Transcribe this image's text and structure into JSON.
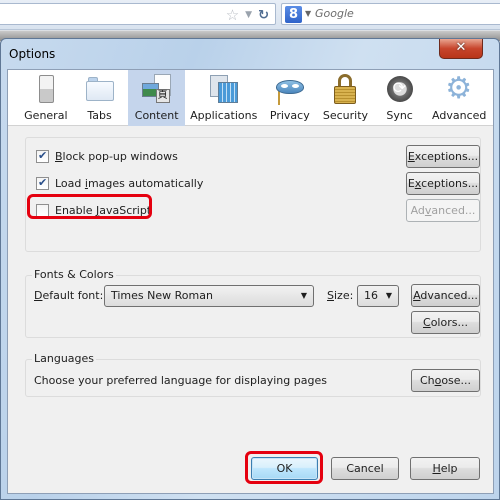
{
  "browser": {
    "bookmark_icon": "star-icon",
    "dropmarker_icon": "dropdown-arrow-icon",
    "reload_icon": "reload-icon",
    "search_engine_icon": "google-icon",
    "search_engine_letter": "8",
    "search_placeholder": "Google"
  },
  "dialog": {
    "title": "Options",
    "close_symbol": "✕",
    "panes": [
      {
        "label": "General",
        "icon": "switch-icon",
        "selected": false
      },
      {
        "label": "Tabs",
        "icon": "folder-tab-icon",
        "selected": false
      },
      {
        "label": "Content",
        "icon": "content-icon",
        "selected": true
      },
      {
        "label": "Applications",
        "icon": "applications-icon",
        "selected": false
      },
      {
        "label": "Privacy",
        "icon": "mask-icon",
        "selected": false
      },
      {
        "label": "Security",
        "icon": "padlock-icon",
        "selected": false
      },
      {
        "label": "Sync",
        "icon": "sync-icon",
        "selected": false
      },
      {
        "label": "Advanced",
        "icon": "gear-icon",
        "selected": false
      }
    ],
    "content": {
      "options": [
        {
          "label_pre": "",
          "label_key": "B",
          "label_post": "lock pop-up windows",
          "checked": true,
          "button": {
            "pre": "",
            "key": "E",
            "post": "xceptions...",
            "disabled": false
          }
        },
        {
          "label_pre": "Load ",
          "label_key": "i",
          "label_post": "mages automatically",
          "checked": true,
          "button": {
            "pre": "E",
            "key": "x",
            "post": "ceptions...",
            "disabled": false
          }
        },
        {
          "label_pre": "Enable ",
          "label_key": "J",
          "label_post": "avaScript",
          "checked": false,
          "button": {
            "pre": "Ad",
            "key": "v",
            "post": "anced...",
            "disabled": true
          }
        }
      ],
      "fonts": {
        "caption": "Fonts & Colors",
        "default_font_label_key": "D",
        "default_font_label_post": "efault font:",
        "default_font_value": "Times New Roman",
        "size_label_key": "S",
        "size_label_post": "ize:",
        "size_value": "16",
        "advanced_key": "A",
        "advanced_post": "dvanced...",
        "colors_key": "C",
        "colors_post": "olors..."
      },
      "languages": {
        "caption": "Languages",
        "description": "Choose your preferred language for displaying pages",
        "choose_pre": "Ch",
        "choose_key": "o",
        "choose_post": "ose..."
      }
    },
    "footer": {
      "ok": "OK",
      "cancel": "Cancel",
      "help_key": "H",
      "help_post": "elp"
    },
    "annotation_color": "#e5000f"
  }
}
